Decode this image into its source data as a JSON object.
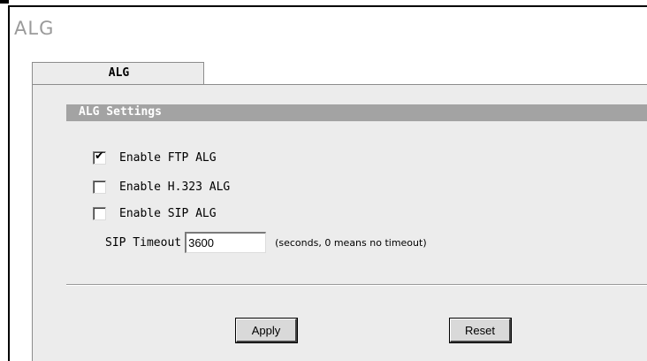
{
  "page": {
    "title": "ALG"
  },
  "tabs": [
    {
      "label": "ALG",
      "active": true
    }
  ],
  "section": {
    "title": "ALG Settings"
  },
  "options": [
    {
      "label": "Enable FTP ALG",
      "checked": true
    },
    {
      "label": "Enable H.323 ALG",
      "checked": false
    },
    {
      "label": "Enable SIP ALG",
      "checked": false
    }
  ],
  "sip_timeout": {
    "label": "SIP Timeout",
    "value": "3600",
    "hint": "(seconds, 0 means no timeout)"
  },
  "buttons": {
    "apply": "Apply",
    "reset": "Reset"
  },
  "colors": {
    "panel_bg": "#ececec",
    "section_header_bg": "#a3a3a3",
    "title_gray": "#9a9a9a"
  }
}
